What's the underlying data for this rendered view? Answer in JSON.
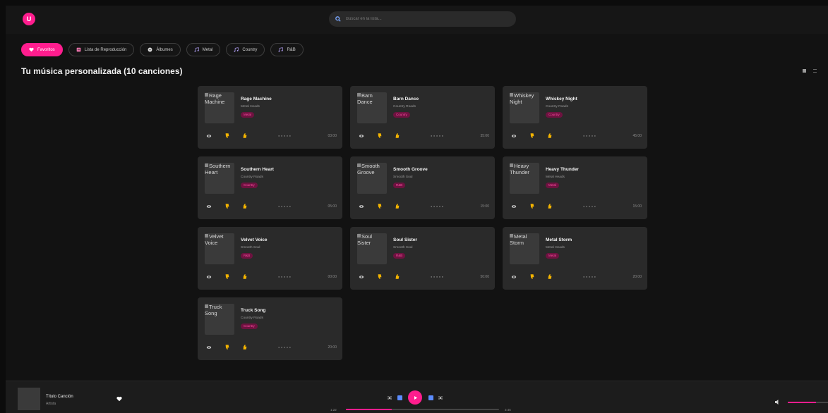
{
  "header": {
    "avatar_initial": "U",
    "search_placeholder": "Buscar en la lista...",
    "accent": "#ff1d8e"
  },
  "tabs": [
    {
      "label": "Favoritos",
      "icon": "heart-icon",
      "active": true
    },
    {
      "label": "Lista de Reproducción",
      "icon": "list-icon",
      "active": false
    },
    {
      "label": "Álbumes",
      "icon": "album-icon",
      "active": false
    },
    {
      "label": "Metal",
      "icon": "music-note-icon",
      "active": false
    },
    {
      "label": "Country",
      "icon": "music-note-icon",
      "active": false
    },
    {
      "label": "R&B",
      "icon": "music-note-icon",
      "active": false
    }
  ],
  "page_title": "Tu música personalizada (10 canciones)",
  "songs": [
    {
      "title": "Rage Machine",
      "artist": "Metal Heads",
      "genre": "Metal",
      "cover_alt": "Rage Machine",
      "duration": "03:00"
    },
    {
      "title": "Barn Dance",
      "artist": "Country Roads",
      "genre": "Country",
      "cover_alt": "Barn Dance",
      "duration": "35:00"
    },
    {
      "title": "Whiskey Night",
      "artist": "Country Roads",
      "genre": "Country",
      "cover_alt": "Whiskey Night",
      "duration": "45:00"
    },
    {
      "title": "Southern Heart",
      "artist": "Country Roads",
      "genre": "Country",
      "cover_alt": "Southern Heart",
      "duration": "05:00"
    },
    {
      "title": "Smooth Groove",
      "artist": "Smooth Soul",
      "genre": "R&B",
      "cover_alt": "Smooth Groove",
      "duration": "15:00"
    },
    {
      "title": "Heavy Thunder",
      "artist": "Metal Heads",
      "genre": "Metal",
      "cover_alt": "Heavy Thunder",
      "duration": "15:00"
    },
    {
      "title": "Velvet Voice",
      "artist": "Smooth Soul",
      "genre": "R&B",
      "cover_alt": "Velvet Voice",
      "duration": "00:00"
    },
    {
      "title": "Soul Sister",
      "artist": "Smooth Soul",
      "genre": "R&B",
      "cover_alt": "Soul Sister",
      "duration": "50:00"
    },
    {
      "title": "Metal Storm",
      "artist": "Metal Heads",
      "genre": "Metal",
      "cover_alt": "Metal Storm",
      "duration": "20:00"
    },
    {
      "title": "Truck Song",
      "artist": "Country Roads",
      "genre": "Country",
      "cover_alt": "Truck Song",
      "duration": "20:00"
    }
  ],
  "player": {
    "title": "Título Canción",
    "artist": "Artista",
    "current_time": "1:22",
    "total_time": "3:45",
    "progress": 0.3,
    "volume": 0.7
  }
}
